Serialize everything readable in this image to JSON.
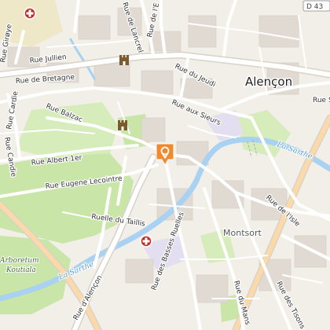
{
  "map": {
    "city_label": "Alençon",
    "district_label": "Montsort",
    "poi_labels": [
      "Arboretum",
      "Koutiala"
    ],
    "river_labels": [
      "La Sarthe",
      "La Sarthe"
    ],
    "road_badge": "D 43",
    "street_labels": [
      "Rue Jullien",
      "Rue de Bretagne",
      "Rue Balzac",
      "Rue Albert 1er",
      "Rue Eugene Lecointre",
      "Ruelle du Taillis",
      "Rue d'Alençon",
      "Rue des Basses Ruelles",
      "Rue du Mans",
      "Rue des Tisons",
      "Rue de l'Isle",
      "Rue aux Sieurs",
      "Rue du Jeudi",
      "Rue de Lancrel",
      "Rue de l'E",
      "Rue Cardie",
      "Rue Candie",
      "Rue Girøye",
      "Rue S"
    ],
    "colors": {
      "background": "#f2efe9",
      "park": "#c9e6a8",
      "water": "#a8d1f2",
      "road": "#ffffff",
      "building": "#e0dad2",
      "pedestrian": "#e3dff0",
      "marker": "#f08a2c",
      "hospital": "#c62828"
    },
    "icons": [
      "location-pin-icon",
      "hospital-icon",
      "castle-icon"
    ]
  }
}
